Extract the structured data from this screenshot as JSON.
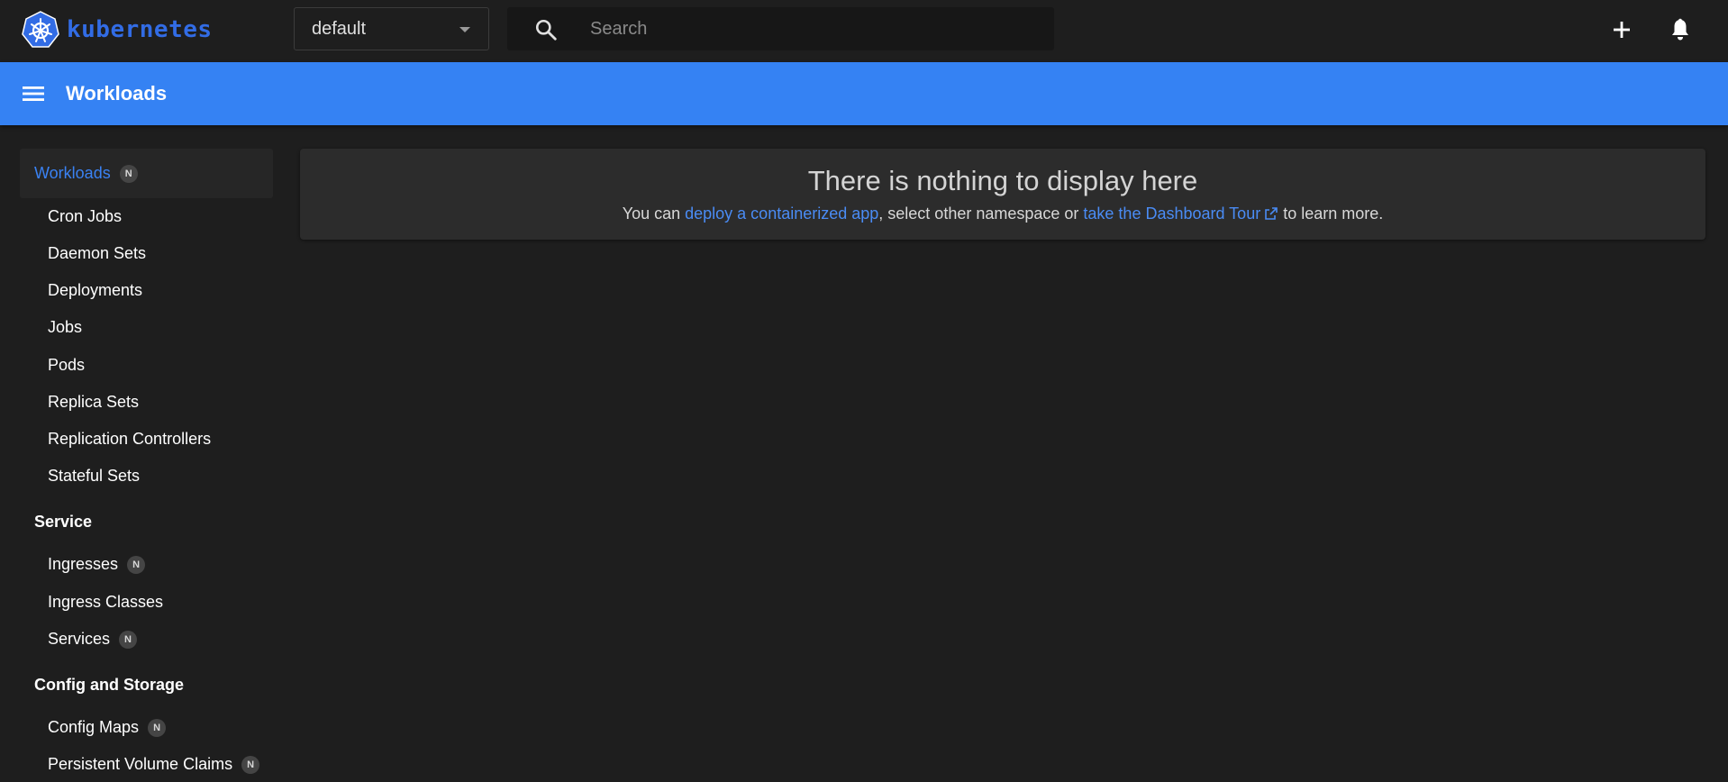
{
  "header": {
    "brand": "kubernetes",
    "namespace": {
      "selected": "default"
    },
    "search": {
      "placeholder": "Search"
    },
    "icons": {
      "logo": "kubernetes-helm-icon",
      "search": "search-icon",
      "create": "plus-icon",
      "notifications": "bell-icon"
    }
  },
  "titlebar": {
    "title": "Workloads",
    "menu_icon": "hamburger-menu-icon",
    "accent_color": "#3582f3"
  },
  "sidebar": {
    "active_group": {
      "label": "Workloads",
      "badge": "N",
      "color": "#3a82f3"
    },
    "workloads": [
      {
        "label": "Cron Jobs"
      },
      {
        "label": "Daemon Sets"
      },
      {
        "label": "Deployments"
      },
      {
        "label": "Jobs"
      },
      {
        "label": "Pods"
      },
      {
        "label": "Replica Sets"
      },
      {
        "label": "Replication Controllers"
      },
      {
        "label": "Stateful Sets"
      }
    ],
    "service_section": "Service",
    "service": [
      {
        "label": "Ingresses",
        "badge": "N"
      },
      {
        "label": "Ingress Classes"
      },
      {
        "label": "Services",
        "badge": "N"
      }
    ],
    "config_section": "Config and Storage",
    "config": [
      {
        "label": "Config Maps",
        "badge": "N"
      },
      {
        "label": "Persistent Volume Claims",
        "badge": "N"
      }
    ]
  },
  "main": {
    "empty_title": "There is nothing to display here",
    "empty_text": {
      "prefix": "You can ",
      "link1": "deploy a containerized app",
      "middle": ", select other namespace or ",
      "link2": "take the Dashboard Tour",
      "link2_icon": "external-link-icon",
      "suffix": " to learn more."
    }
  }
}
